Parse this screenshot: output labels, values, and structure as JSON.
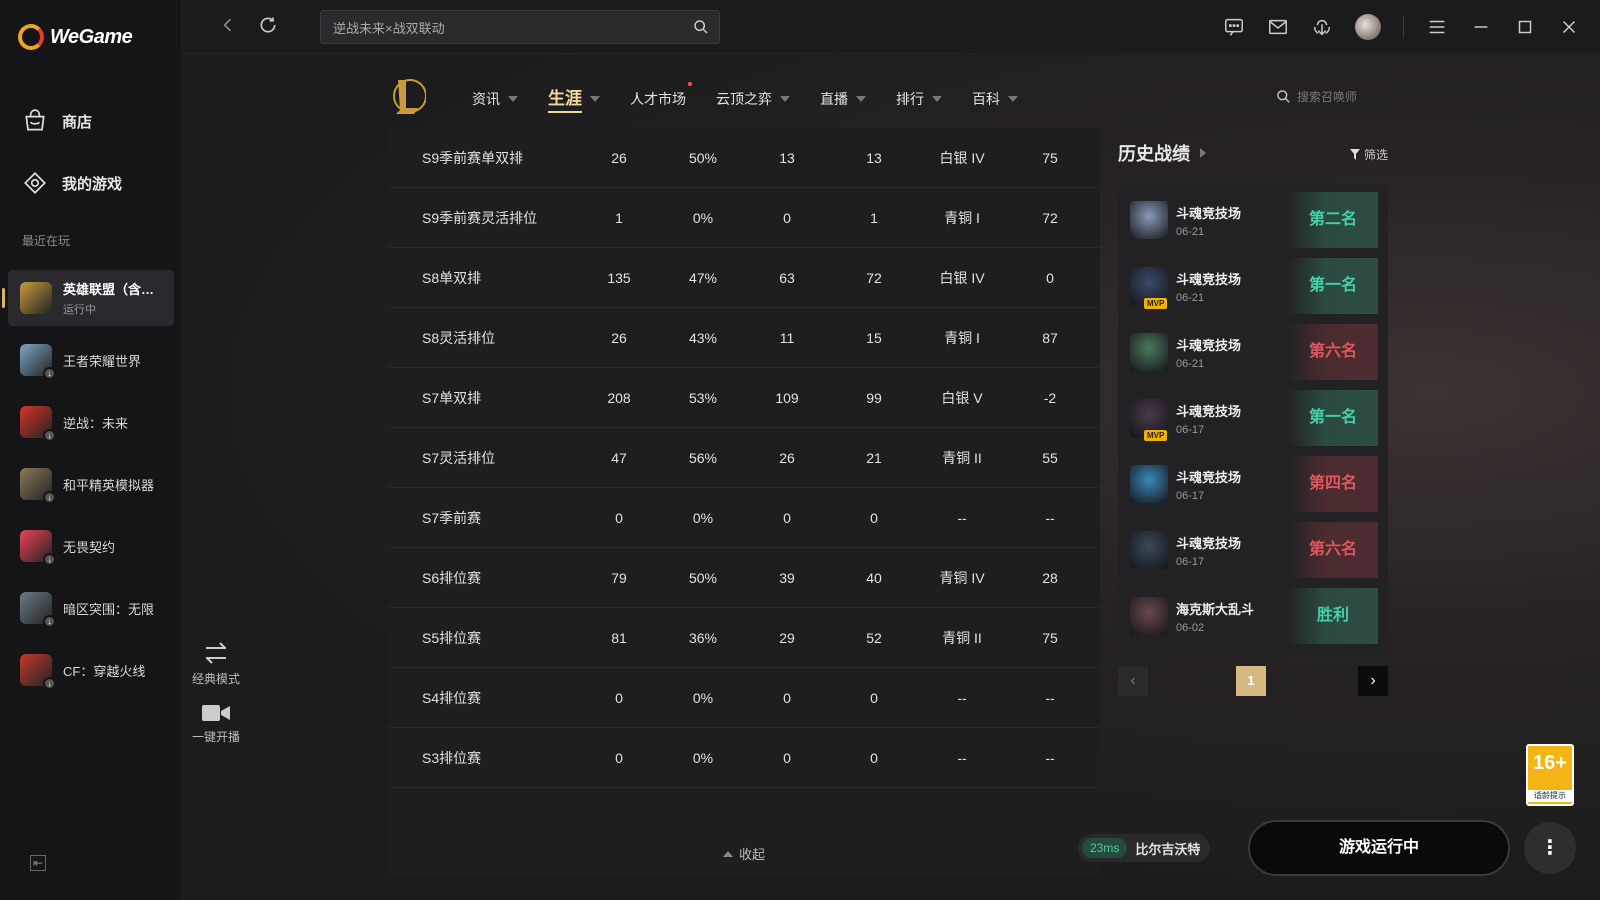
{
  "app": {
    "logo_text": "WeGame"
  },
  "sidebar": {
    "nav": [
      {
        "label": "商店",
        "icon": "store-icon"
      },
      {
        "label": "我的游戏",
        "icon": "my-games-icon"
      }
    ],
    "recent_label": "最近在玩",
    "games": [
      {
        "name": "英雄联盟（含经典模式）",
        "status": "运行中",
        "color": "#c89b3c"
      },
      {
        "name": "王者荣耀世界",
        "status": "",
        "color": "#7ea6c6"
      },
      {
        "name": "逆战：未来",
        "status": "",
        "color": "#d8342a"
      },
      {
        "name": "和平精英模拟器",
        "status": "",
        "color": "#8a7a5a"
      },
      {
        "name": "无畏契约",
        "status": "",
        "color": "#e84357"
      },
      {
        "name": "暗区突围：无限",
        "status": "",
        "color": "#6a7c88"
      },
      {
        "name": "CF：穿越火线",
        "status": "",
        "color": "#c43a2a"
      }
    ]
  },
  "topbar": {
    "search_value": "逆战未来×战双联动"
  },
  "tabs": [
    {
      "label": "资讯",
      "caret": true,
      "active": false,
      "dot": false
    },
    {
      "label": "生涯",
      "caret": true,
      "active": true,
      "dot": false
    },
    {
      "label": "人才市场",
      "caret": false,
      "active": false,
      "dot": true
    },
    {
      "label": "云顶之弈",
      "caret": true,
      "active": false,
      "dot": false
    },
    {
      "label": "直播",
      "caret": true,
      "active": false,
      "dot": false
    },
    {
      "label": "排行",
      "caret": true,
      "active": false,
      "dot": false
    },
    {
      "label": "百科",
      "caret": true,
      "active": false,
      "dot": false
    }
  ],
  "summoner_search_placeholder": "搜索召唤师",
  "season_table": {
    "rows": [
      [
        "S9季前赛单双排",
        "26",
        "50%",
        "13",
        "13",
        "白银 IV",
        "75"
      ],
      [
        "S9季前赛灵活排位",
        "1",
        "0%",
        "0",
        "1",
        "青铜 I",
        "72"
      ],
      [
        "S8单双排",
        "135",
        "47%",
        "63",
        "72",
        "白银 IV",
        "0"
      ],
      [
        "S8灵活排位",
        "26",
        "43%",
        "11",
        "15",
        "青铜 I",
        "87"
      ],
      [
        "S7单双排",
        "208",
        "53%",
        "109",
        "99",
        "白银 V",
        "-2"
      ],
      [
        "S7灵活排位",
        "47",
        "56%",
        "26",
        "21",
        "青铜 II",
        "55"
      ],
      [
        "S7季前赛",
        "0",
        "0%",
        "0",
        "0",
        "--",
        "--"
      ],
      [
        "S6排位赛",
        "79",
        "50%",
        "39",
        "40",
        "青铜 IV",
        "28"
      ],
      [
        "S5排位赛",
        "81",
        "36%",
        "29",
        "52",
        "青铜 II",
        "75"
      ],
      [
        "S4排位赛",
        "0",
        "0%",
        "0",
        "0",
        "--",
        "--"
      ],
      [
        "S3排位赛",
        "0",
        "0%",
        "0",
        "0",
        "--",
        "--"
      ]
    ],
    "collapse_label": "收起"
  },
  "side_tools": [
    {
      "label": "经典模式"
    },
    {
      "label": "一键开播"
    }
  ],
  "history": {
    "title": "历史战绩",
    "filter_label": "筛选",
    "matches": [
      {
        "mode": "斗魂竞技场",
        "date": "06-21",
        "result": "第二名",
        "win": true,
        "mvp": false,
        "color": "#8a9ab8"
      },
      {
        "mode": "斗魂竞技场",
        "date": "06-21",
        "result": "第一名",
        "win": true,
        "mvp": true,
        "color": "#3a4a6a"
      },
      {
        "mode": "斗魂竞技场",
        "date": "06-21",
        "result": "第六名",
        "win": false,
        "mvp": false,
        "color": "#4a7a5a"
      },
      {
        "mode": "斗魂竞技场",
        "date": "06-17",
        "result": "第一名",
        "win": true,
        "mvp": true,
        "color": "#4a3a4a"
      },
      {
        "mode": "斗魂竞技场",
        "date": "06-17",
        "result": "第四名",
        "win": false,
        "mvp": false,
        "color": "#3a8ab8"
      },
      {
        "mode": "斗魂竞技场",
        "date": "06-17",
        "result": "第六名",
        "win": false,
        "mvp": false,
        "color": "#3a4a5a"
      },
      {
        "mode": "海克斯大乱斗",
        "date": "06-02",
        "result": "胜利",
        "win": true,
        "mvp": false,
        "color": "#6a4a4a"
      }
    ],
    "page": "1"
  },
  "bottom": {
    "ping_ms": "23ms",
    "server": "比尔吉沃特",
    "launch_label": "游戏运行中",
    "more_label": "⋮"
  },
  "age_badge": {
    "age": "16+",
    "tip": "适龄提示"
  }
}
